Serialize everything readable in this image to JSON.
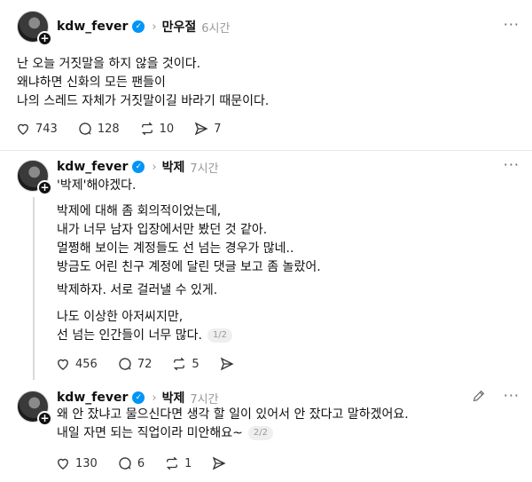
{
  "post1": {
    "username": "kdw_fever",
    "topic": "만우절",
    "time": "6시간",
    "lines": [
      "난 오늘 거짓말을 하지 않을 것이다.",
      "왜냐하면 신화의 모든 팬들이",
      "나의 스레드 자체가 거짓말이길 바라기 때문이다."
    ],
    "likes": "743",
    "replies": "128",
    "reposts": "10",
    "shares": "7"
  },
  "post2": {
    "username": "kdw_fever",
    "topic": "박제",
    "time": "7시간",
    "first_line": "'박제'해야겠다.",
    "para1": [
      "박제에 대해 좀 회의적이었는데,",
      "내가 너무 남자 입장에서만 봤던 것 같아.",
      "멀쩡해 보이는 계정들도 선 넘는 경우가 많네..",
      "방금도 어린 친구 계정에 달린 댓글 보고 좀 놀랐어."
    ],
    "para2": "박제하자. 서로 걸러낼 수 있게.",
    "para3_line1": "나도 이상한 아저씨지만,",
    "para3_line2": "선 넘는 인간들이 너무 많다.",
    "pager": "1/2",
    "likes": "456",
    "replies": "72",
    "reposts": "5"
  },
  "post3": {
    "username": "kdw_fever",
    "topic": "박제",
    "time": "7시간",
    "line1": "왜 안 잤냐고 물으신다면 생각 할 일이 있어서 안 잤다고 말하겠어요.",
    "line2": "내일 자면 되는 직업이라 미안해요~",
    "pager": "2/2",
    "likes": "130",
    "replies": "6",
    "reposts": "1"
  },
  "icons": {
    "more": "···",
    "verified": "✓",
    "chevron": "›",
    "plus": "+"
  }
}
